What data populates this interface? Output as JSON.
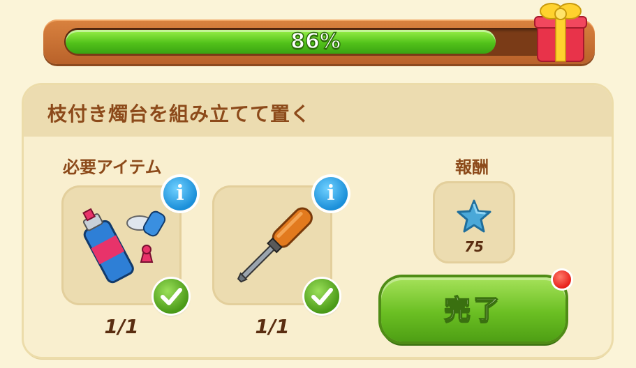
{
  "progress": {
    "value_percent": 86,
    "label": "86%"
  },
  "task": {
    "title": "枝付き燭台を組み立てて置く"
  },
  "required_items": {
    "label": "必要アイテム",
    "items": [
      {
        "icon": "glue-tube-icon",
        "count": "1/1"
      },
      {
        "icon": "screwdriver-icon",
        "count": "1/1"
      }
    ]
  },
  "reward": {
    "label": "報酬",
    "icon": "blue-star-icon",
    "amount": "75"
  },
  "complete_button": {
    "label": "完了"
  },
  "colors": {
    "accent_green": "#6bbf23",
    "info_blue": "#1b8fd9",
    "title_brown": "#8c4a1a"
  }
}
